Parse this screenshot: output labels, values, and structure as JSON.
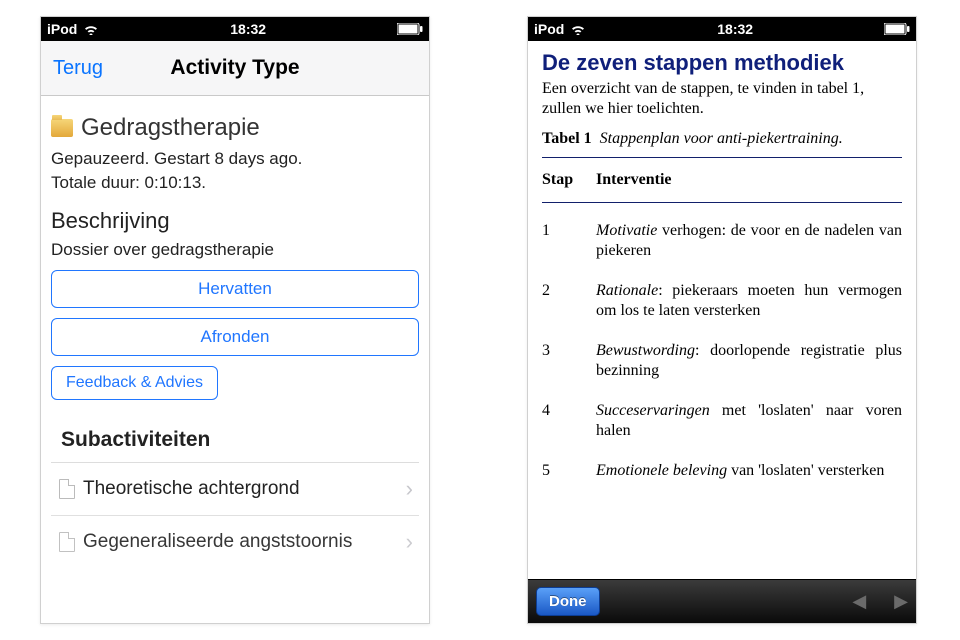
{
  "statusbar": {
    "device": "iPod",
    "time": "18:32"
  },
  "left": {
    "back": "Terug",
    "title": "Activity Type",
    "activity": "Gedragstherapie",
    "status_line1": "Gepauzeerd. Gestart 8 days ago.",
    "status_line2": "Totale duur: 0:10:13.",
    "desc_header": "Beschrijving",
    "desc_text": "Dossier over gedragstherapie",
    "btn_resume": "Hervatten",
    "btn_finish": "Afronden",
    "btn_feedback": "Feedback & Advies",
    "sub_header": "Subactiviteiten",
    "sub_items": [
      "Theoretische achtergrond",
      "Gegeneraliseerde angststoornis"
    ]
  },
  "right": {
    "title": "De zeven stappen methodiek",
    "subtitle": "Een overzicht van de stappen, te vinden in tabel 1, zullen we hier toelichten.",
    "tabel_label": "Tabel 1",
    "tabel_caption": "Stappenplan voor anti-piekertraining.",
    "col1": "Stap",
    "col2": "Interventie",
    "rows": [
      {
        "n": "1",
        "em": "Motivatie",
        "rest": " verhogen: de voor en de nadelen van piekeren"
      },
      {
        "n": "2",
        "em": "Rationale",
        "rest": ": piekeraars moeten hun vermogen om los te laten versterken"
      },
      {
        "n": "3",
        "em": "Bewustwording",
        "rest": ": doorlopende registratie plus bezinning"
      },
      {
        "n": "4",
        "em": "Succeservaringen",
        "rest": " met 'loslaten' naar voren halen"
      },
      {
        "n": "5",
        "em": "Emotionele beleving",
        "rest": " van 'loslaten' versterken"
      }
    ],
    "done": "Done"
  }
}
